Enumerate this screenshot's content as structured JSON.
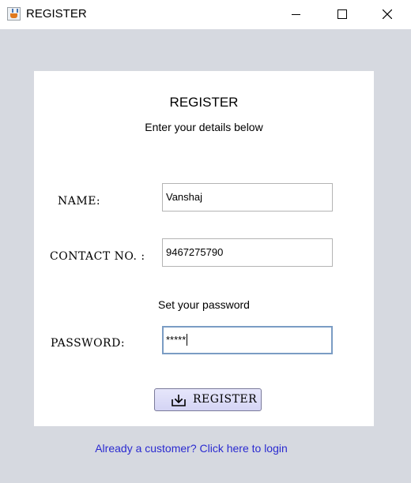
{
  "window": {
    "title": "REGISTER",
    "app_icon": "java-cup-icon",
    "controls": [
      "minimize-icon",
      "maximize-icon",
      "close-icon"
    ]
  },
  "form": {
    "heading": "REGISTER",
    "subheading": "Enter your details below",
    "name": {
      "label": "NAME:",
      "value": "Vanshaj"
    },
    "contact": {
      "label": "CONTACT NO. :",
      "value": "9467275790"
    },
    "password_hint": "Set your password",
    "password": {
      "label": "PASSWORD:",
      "value": "*****"
    },
    "register_button": {
      "label": "REGISTER",
      "icon": "download-tray-icon"
    }
  },
  "login_link": "Already a customer? Click here to login",
  "colors": {
    "background": "#d6d9e0",
    "panel": "#ffffff",
    "button_fill": "#dcdcf8",
    "link": "#2a2ad0",
    "focus_border": "#7a9cc4"
  }
}
